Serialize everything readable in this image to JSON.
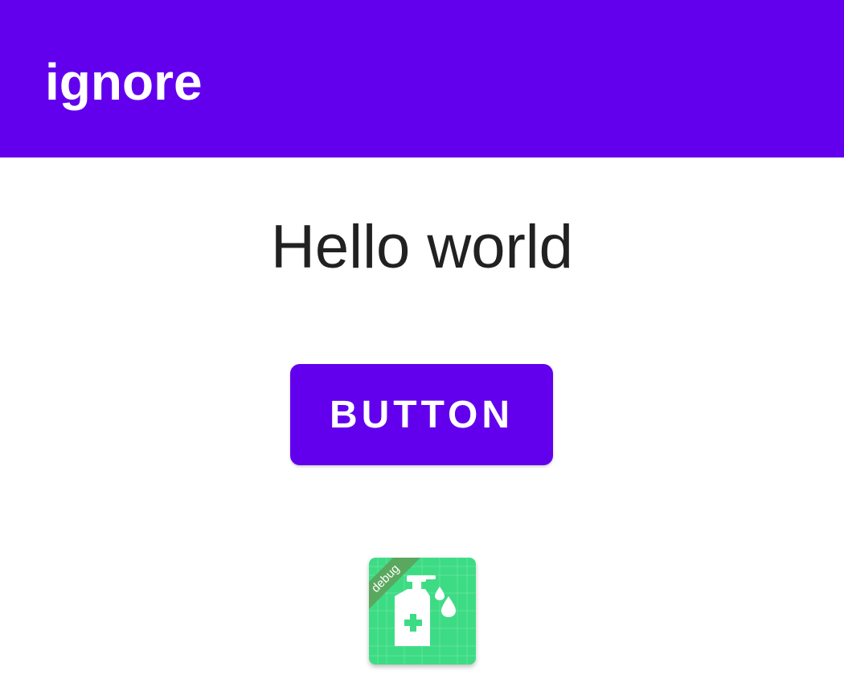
{
  "app_bar": {
    "title": "ignore",
    "color": "#6200EE"
  },
  "main": {
    "hello_text": "Hello world",
    "button_label": "BUTTON"
  },
  "app_icon": {
    "icon": "hand-sanitizer-icon",
    "badge": "debug",
    "background_color": "#3DDC84",
    "badge_color": "#5AA85F"
  }
}
